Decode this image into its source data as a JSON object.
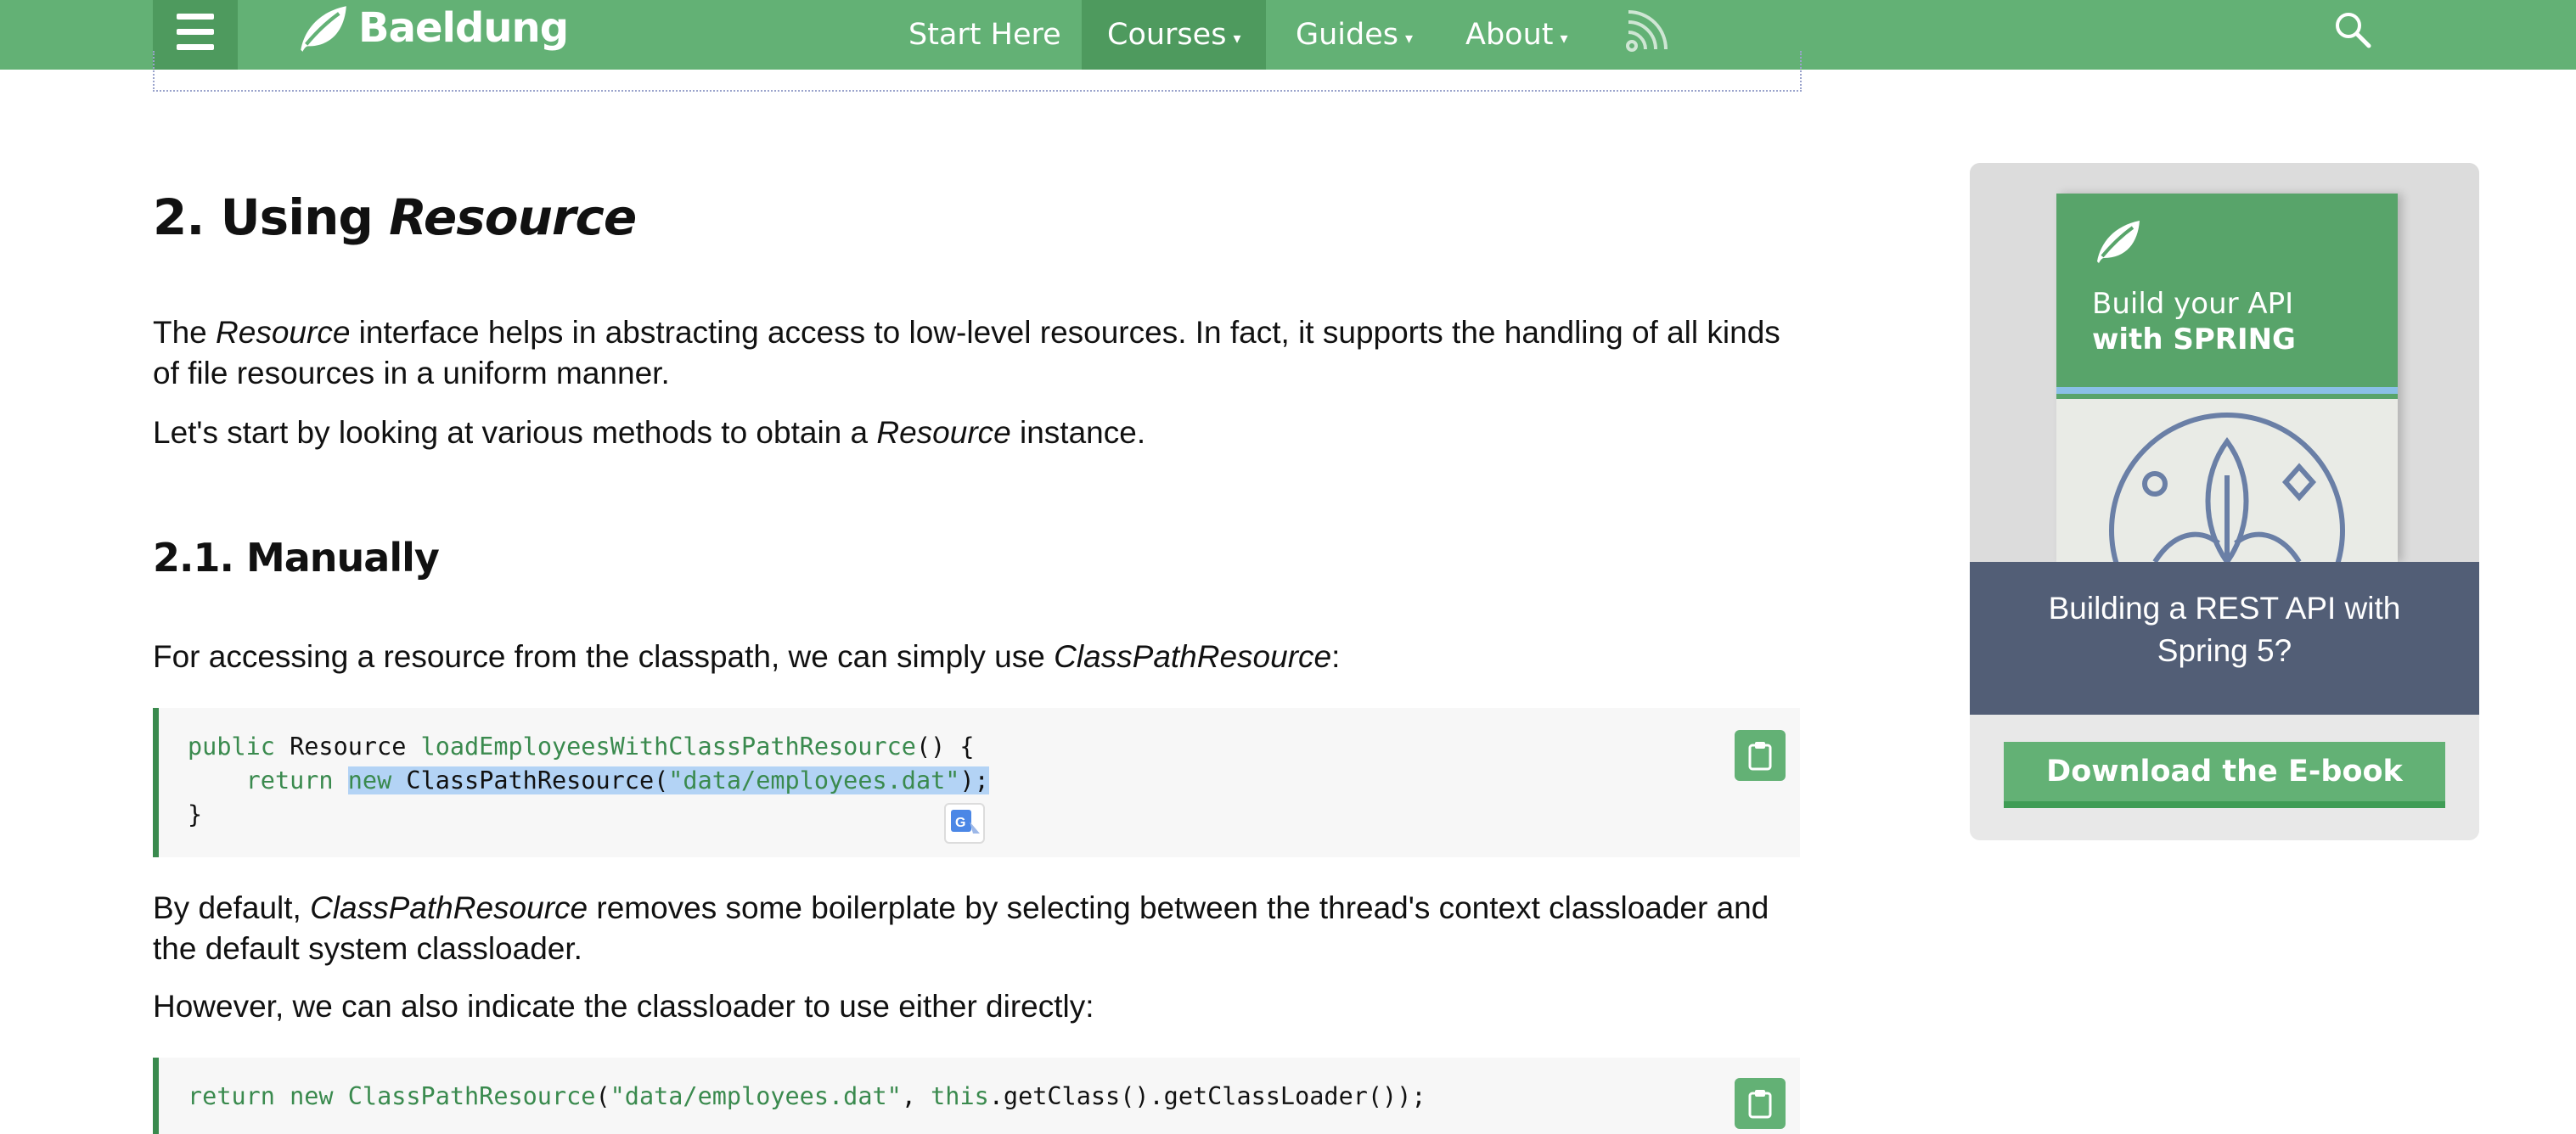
{
  "nav": {
    "logo_text": "Baeldung",
    "items": [
      {
        "label": "Start Here",
        "has_caret": false
      },
      {
        "label": "Courses",
        "has_caret": true
      },
      {
        "label": "Guides",
        "has_caret": true
      },
      {
        "label": "About",
        "has_caret": true
      }
    ],
    "caret": "▾"
  },
  "article": {
    "h2_prefix": "2. Using ",
    "h2_italic": "Resource",
    "p1_a": "The ",
    "p1_em": "Resource",
    "p1_b": " interface helps in abstracting access to low-level resources. In fact, it supports the handling of all kinds of file resources in a uniform manner.",
    "p2_a": "Let's start by looking at various methods to obtain a ",
    "p2_em": "Resource",
    "p2_b": " instance.",
    "h3": "2.1. Manually",
    "p3_a": "For accessing a resource from the classpath, we can simply use ",
    "p3_em": "ClassPathResource",
    "p3_b": ":",
    "code1": {
      "l1_kw": "public",
      "l1_type": " Resource ",
      "l1_fn": "loadEmployeesWithClassPathResource",
      "l1_rest": "() {",
      "l2_indent": "    ",
      "l2_kw": "return",
      "l2_sp": " ",
      "l2_sel_kw": "new",
      "l2_sel_cls": " ClassPathResource(",
      "l2_sel_str": "\"data/employees.dat\"",
      "l2_sel_end": ");",
      "l3": "}"
    },
    "p4_a": "By default, ",
    "p4_em": "ClassPathResource",
    "p4_b": " removes some boilerplate by selecting between the thread's context classloader and the default system classloader.",
    "p5": "However, we can also indicate the classloader to use either directly:",
    "code2": {
      "kw1": "return",
      "kw2": " new",
      "cls": " ClassPathResource",
      "p1": "(",
      "str": "\"data/employees.dat\"",
      "comma": ", ",
      "kw3": "this",
      "rest": ".getClass().getClassLoader());"
    }
  },
  "sidebar": {
    "book_line1": "Build your API",
    "book_line2": "with SPRING",
    "caption_line1": "Building a REST API with",
    "caption_line2": "Spring 5?",
    "download_label": "Download the E-book"
  },
  "colors": {
    "nav_green": "#63b175",
    "nav_active": "#4e9a5e",
    "code_green": "#3a8a4e",
    "sidebar_caption_bg": "#525e76",
    "selection": "#b3d3f5"
  },
  "icons": {
    "menu": "hamburger-menu-icon",
    "logo": "leaf-logo-icon",
    "rss": "rss-feed-icon",
    "search": "search-icon",
    "copy": "clipboard-copy-icon",
    "translate": "google-translate-icon"
  }
}
